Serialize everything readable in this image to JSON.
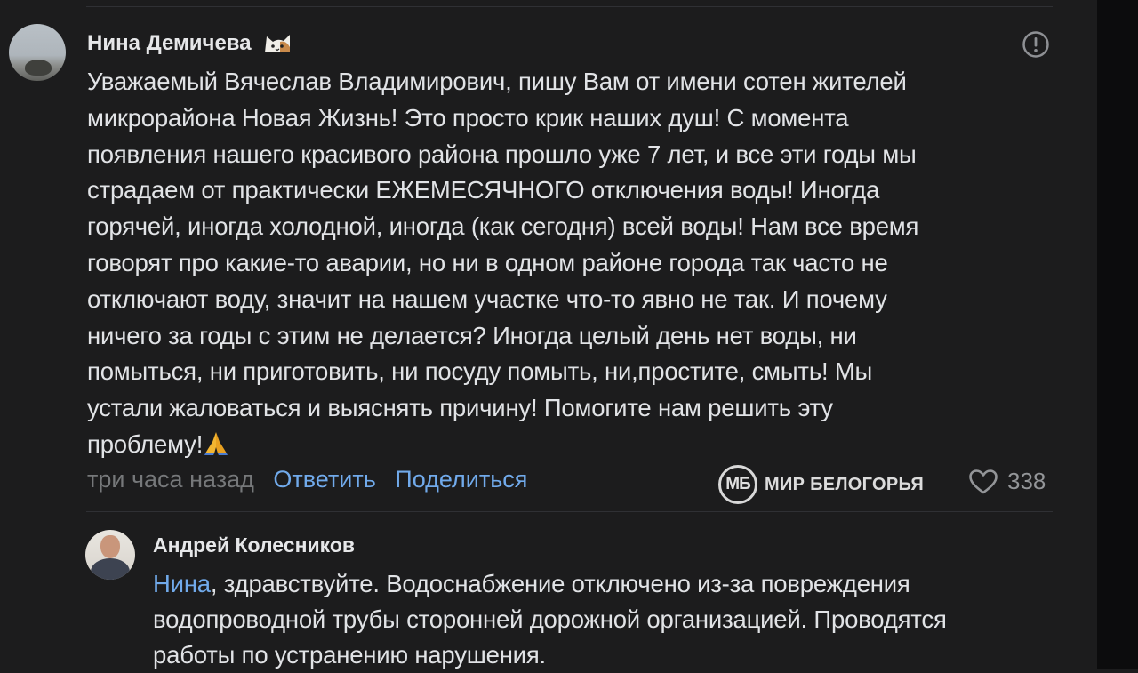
{
  "comment": {
    "author": "Нина Демичева",
    "text": "Уважаемый Вячеслав Владимирович, пишу Вам от имени сотен жителей\nмикрорайона Новая Жизнь! Это просто крик наших душ! С момента\nпоявления нашего красивого района прошло уже 7 лет, и все эти годы мы\nстрадаем от практически ЕЖЕМЕСЯЧНОГО отключения воды! Иногда\nгорячей, иногда холодной, иногда (как сегодня) всей воды! Нам все время\nговорят про какие-то аварии, но ни в одном районе города так часто не\nотключают воду, значит на нашем участке что-то явно не так. И почему\nничего за годы с этим не делается? Иногда целый день нет воды, ни\nпомыться, ни приготовить, ни посуду помыть, ни,простите, смыть! Мы\nустали жаловаться и выяснять причину! Помогите нам решить эту\nпроблему!",
    "time": "три часа назад",
    "reply_label": "Ответить",
    "share_label": "Поделиться",
    "likes": "338",
    "emoji_name": "cat-emoji",
    "end_emoji_name": "folded-hands-emoji"
  },
  "watermark": {
    "logo": "МБ",
    "text": "МИР БЕЛОГОРЬЯ"
  },
  "reply": {
    "author": "Андрей Колесников",
    "mention": "Нина",
    "text": ", здравствуйте. Водоснабжение отключено из-за повреждения\nводопроводной трубы сторонней дорожной организацией. Проводятся\nработы по устранению нарушения."
  },
  "colors": {
    "background": "#1c1c1d",
    "link": "#71aaeb",
    "muted": "#76787a",
    "text": "#e1e3e6"
  }
}
